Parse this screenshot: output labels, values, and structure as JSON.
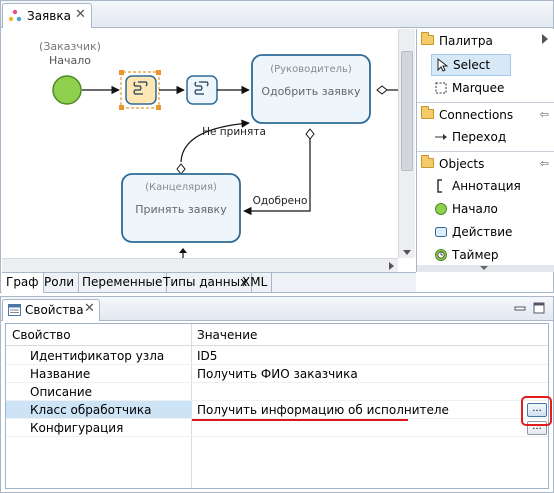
{
  "editor": {
    "tab_title": "Заявка",
    "bottom_tabs": [
      "Граф",
      "Роли",
      "Переменные",
      "Типы данных",
      "XML"
    ],
    "active_bottom_tab": "Граф"
  },
  "diagram": {
    "start": {
      "role": "(Заказчик)",
      "label": "Начало"
    },
    "approve": {
      "role": "(Руководитель)",
      "label": "Одобрить заявку"
    },
    "accept": {
      "role": "(Канцелярия)",
      "label": "Принять заявку"
    },
    "edge_rejected": "Не принята",
    "edge_approved": "Одобрено"
  },
  "palette": {
    "title": "Палитра",
    "tools": [
      {
        "label": "Select",
        "icon": "select-arrow-icon",
        "selected": true
      },
      {
        "label": "Marquee",
        "icon": "marquee-icon",
        "selected": false
      }
    ],
    "connections_group": "Connections",
    "connections": [
      {
        "label": "Переход",
        "icon": "transition-arrow-icon"
      }
    ],
    "objects_group": "Objects",
    "objects": [
      {
        "label": "Аннотация",
        "icon": "annotation-icon"
      },
      {
        "label": "Начало",
        "icon": "start-event-icon"
      },
      {
        "label": "Действие",
        "icon": "action-icon"
      },
      {
        "label": "Таймер",
        "icon": "timer-icon"
      }
    ]
  },
  "properties": {
    "tab_title": "Свойства",
    "col_property": "Свойство",
    "col_value": "Значение",
    "rows": [
      {
        "key": "Идентификатор узла",
        "value": "ID5"
      },
      {
        "key": "Название",
        "value": "Получить ФИО заказчика"
      },
      {
        "key": "Описание",
        "value": ""
      },
      {
        "key": "Класс обработчика",
        "value": "Получить информацию об исполнителе"
      },
      {
        "key": "Конфигурация",
        "value": ""
      }
    ],
    "ellipsis": "..."
  },
  "colors": {
    "node_border": "#2f6b96",
    "node_fill": "#eef6fc",
    "start_fill": "#8fd14f",
    "selection": "#e8962d",
    "highlight_red": "#e21d1d",
    "row_selected": "#cde4f7"
  }
}
